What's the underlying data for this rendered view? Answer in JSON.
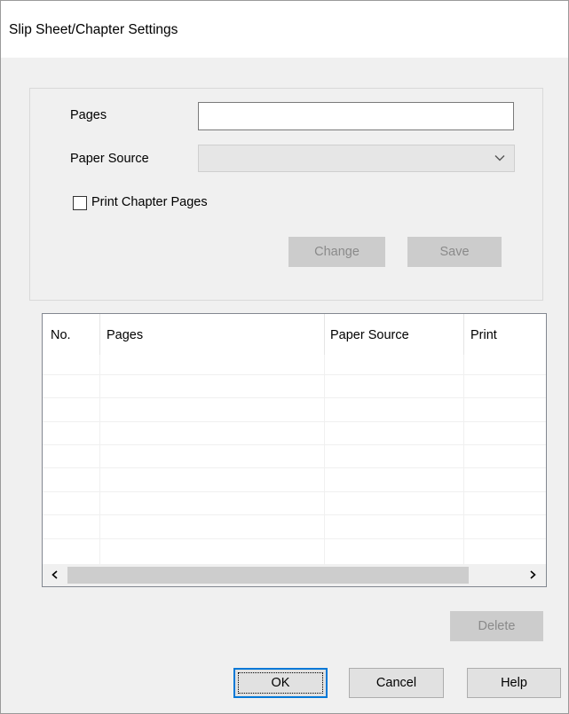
{
  "dialog": {
    "title": "Slip Sheet/Chapter Settings"
  },
  "form": {
    "pages_label": "Pages",
    "pages_value": "",
    "paper_source_label": "Paper Source",
    "paper_source_value": "",
    "print_chapter_label": "Print Chapter Pages",
    "print_chapter_checked": false,
    "change_button": "Change",
    "save_button": "Save"
  },
  "table": {
    "columns": [
      "No.",
      "Pages",
      "Paper Source",
      "Print"
    ],
    "rows": []
  },
  "buttons": {
    "delete": "Delete",
    "ok": "OK",
    "cancel": "Cancel",
    "help": "Help"
  },
  "icons": {
    "dropdown": "chevron-down-icon",
    "scroll_left": "scroll-left-arrow-icon",
    "scroll_right": "scroll-right-arrow-icon"
  }
}
